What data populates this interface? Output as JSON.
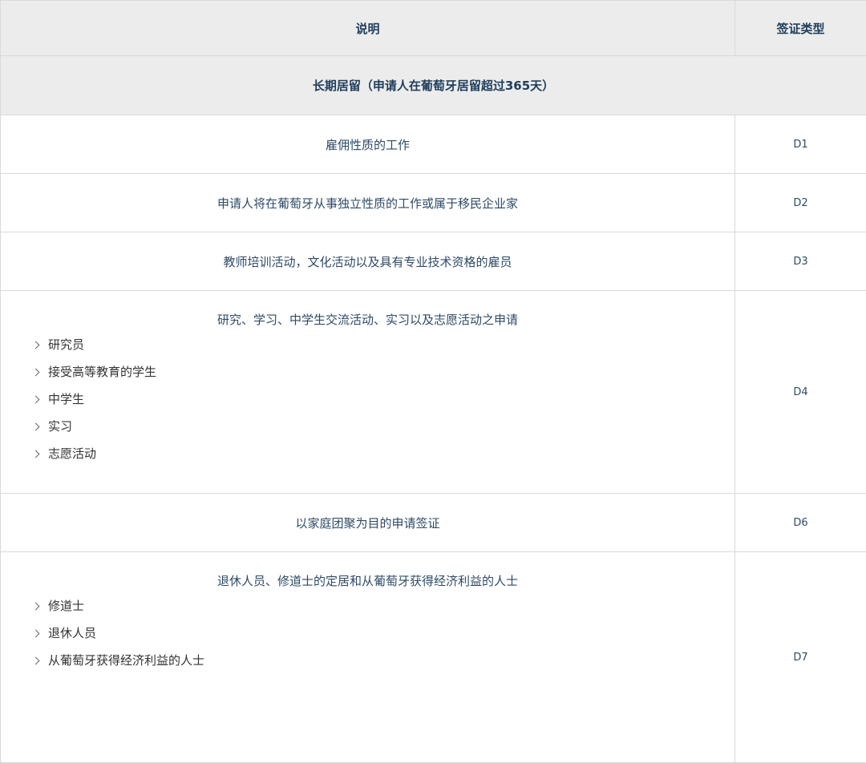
{
  "header": {
    "col_description": "说明",
    "col_visa_type": "签证类型"
  },
  "section": {
    "title": "长期居留（申请人在葡萄牙居留超过365天）"
  },
  "rows": [
    {
      "description": "雇佣性质的工作",
      "visa_type": "D1"
    },
    {
      "description": "申请人将在葡萄牙从事独立性质的工作或属于移民企业家",
      "visa_type": "D2"
    },
    {
      "description": "教师培训活动，文化活动以及具有专业技术资格的雇员",
      "visa_type": "D3"
    },
    {
      "description": "研究、学习、中学生交流活动、实习以及志愿活动之申请",
      "visa_type": "D4",
      "items": [
        "研究员",
        "接受高等教育的学生",
        "中学生",
        "实习",
        "志愿活动"
      ]
    },
    {
      "description": "以家庭团聚为目的申请签证",
      "visa_type": "D6"
    },
    {
      "description": "退休人员、修道士的定居和从葡萄牙获得经济利益的人士",
      "visa_type": "D7",
      "items": [
        "修道士",
        "退休人员",
        "从葡萄牙获得经济利益的人士"
      ]
    }
  ],
  "icons": {
    "list_bullet": "chevron-right-icon"
  },
  "colors": {
    "header_bg": "#ececec",
    "text_primary": "#1f3d5c",
    "border": "#d9d9d9"
  }
}
